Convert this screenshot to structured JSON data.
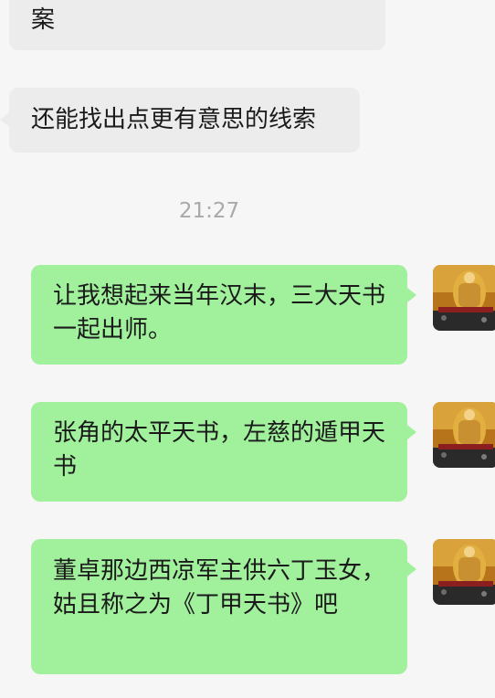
{
  "chat": {
    "incoming": [
      {
        "text": "案"
      },
      {
        "text": "还能找出点更有意思的线索"
      }
    ],
    "timestamp": "21:27",
    "outgoing": [
      {
        "text": "让我想起来当年汉末，三大天书一起出师。"
      },
      {
        "text": "张角的太平天书，左慈的遁甲天书"
      },
      {
        "text": "董卓那边西凉军主供六丁玉女，姑且称之为《丁甲天书》吧"
      }
    ]
  },
  "colors": {
    "page_bg": "#f6f6f6",
    "incoming_bubble": "#ececec",
    "outgoing_bubble": "#a0f09c",
    "timestamp_text": "#a9a9a9"
  },
  "icons": {
    "avatar": "user-avatar-deity-image"
  }
}
